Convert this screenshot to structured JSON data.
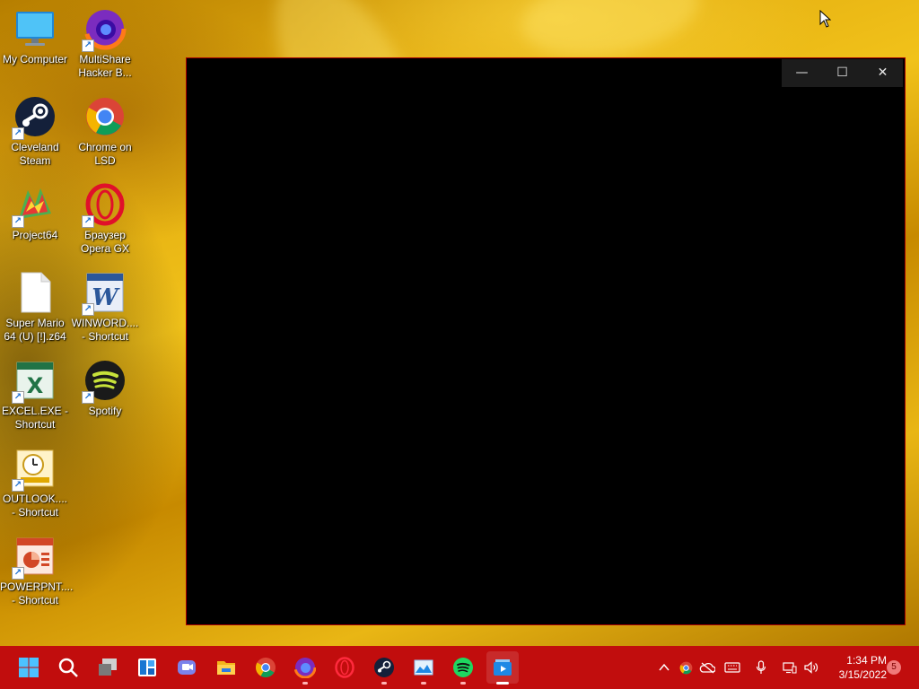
{
  "desktop": {
    "icons": [
      {
        "label": "My Computer",
        "icon": "monitor-icon",
        "shortcut": false
      },
      {
        "label": "MultiShare Hacker B...",
        "icon": "firefox-icon",
        "shortcut": true
      },
      {
        "label": "Cleveland Steam",
        "icon": "steam-icon",
        "shortcut": true
      },
      {
        "label": "Chrome on LSD",
        "icon": "chrome-icon",
        "shortcut": true
      },
      {
        "label": "Project64",
        "icon": "project64-icon",
        "shortcut": true
      },
      {
        "label": "Браузер Opera GX",
        "icon": "opera-gx-icon",
        "shortcut": true
      },
      {
        "label": "Super Mario 64 (U) [!].z64",
        "icon": "file-icon",
        "shortcut": false
      },
      {
        "label": "WINWORD.... - Shortcut",
        "icon": "word-icon",
        "shortcut": true
      },
      {
        "label": "EXCEL.EXE - Shortcut",
        "icon": "excel-icon",
        "shortcut": true
      },
      {
        "label": "Spotify",
        "icon": "spotify-icon",
        "shortcut": true
      },
      {
        "label": "OUTLOOK.... - Shortcut",
        "icon": "outlook-icon",
        "shortcut": true
      },
      {
        "label": "POWERPNT.... - Shortcut",
        "icon": "powerpoint-icon",
        "shortcut": true
      }
    ]
  },
  "window": {
    "minimize_glyph": "—",
    "maximize_glyph": "☐",
    "close_glyph": "✕"
  },
  "taskbar": {
    "color": "#c10d0d",
    "apps": [
      {
        "name": "start-button",
        "icon": "windows-logo-icon"
      },
      {
        "name": "search-button",
        "icon": "search-icon"
      },
      {
        "name": "task-view-button",
        "icon": "task-view-icon"
      },
      {
        "name": "widgets-button",
        "icon": "widgets-icon"
      },
      {
        "name": "teams-chat-button",
        "icon": "chat-icon"
      },
      {
        "name": "file-explorer-button",
        "icon": "folder-icon"
      },
      {
        "name": "chrome-button",
        "icon": "chrome-icon"
      },
      {
        "name": "firefox-button",
        "icon": "firefox-icon"
      },
      {
        "name": "opera-button",
        "icon": "opera-gx-icon"
      },
      {
        "name": "steam-button",
        "icon": "steam-icon"
      },
      {
        "name": "photos-button",
        "icon": "photos-icon"
      },
      {
        "name": "spotify-button",
        "icon": "spotify-icon"
      },
      {
        "name": "media-player-button",
        "icon": "media-player-icon"
      }
    ],
    "tray": {
      "icons": [
        "chevron-up-icon",
        "chrome-tray-icon",
        "onedrive-icon",
        "keyboard-icon",
        "microphone-icon",
        "network-icon",
        "volume-icon"
      ],
      "time": "1:34 PM",
      "date": "3/15/2022",
      "notifications": "5"
    }
  }
}
